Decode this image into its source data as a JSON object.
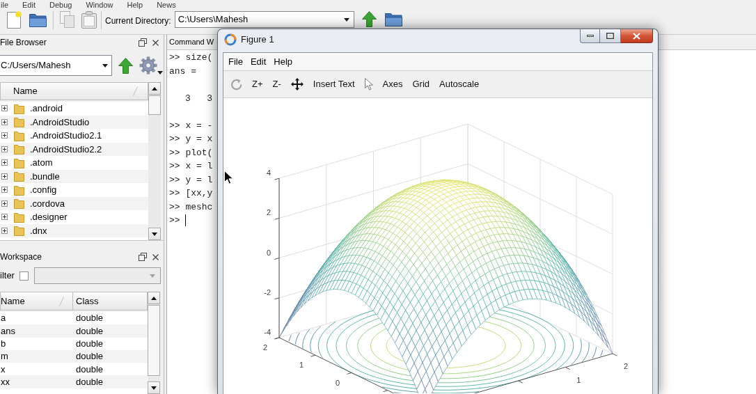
{
  "menu_bar": [
    "ile",
    "Edit",
    "Debug",
    "Window",
    "Help",
    "News"
  ],
  "toolbar": {
    "directory_label": "Current Directory:",
    "directory": "C:\\Users\\Mahesh"
  },
  "file_browser": {
    "title": "File Browser",
    "path": "C:/Users/Mahesh",
    "column": "Name",
    "items": [
      {
        "name": ".android",
        "expanded": false
      },
      {
        "name": ".AndroidStudio",
        "expanded": false
      },
      {
        "name": ".AndroidStudio2.1",
        "expanded": false
      },
      {
        "name": ".AndroidStudio2.2",
        "expanded": false
      },
      {
        "name": ".atom",
        "expanded": false
      },
      {
        "name": ".bundle",
        "expanded": false
      },
      {
        "name": ".config",
        "expanded": false
      },
      {
        "name": ".cordova",
        "expanded": false
      },
      {
        "name": ".designer",
        "expanded": false
      },
      {
        "name": ".dnx",
        "expanded": false
      }
    ]
  },
  "workspace": {
    "title": "Workspace",
    "filter": {
      "label": "ilter",
      "checked": false
    },
    "columns": [
      "Name",
      "Class"
    ],
    "rows": [
      {
        "name": "a",
        "class": "double"
      },
      {
        "name": "ans",
        "class": "double"
      },
      {
        "name": "b",
        "class": "double"
      },
      {
        "name": "m",
        "class": "double"
      },
      {
        "name": "x",
        "class": "double"
      },
      {
        "name": "xx",
        "class": "double"
      }
    ]
  },
  "command_window": {
    "title": "Command W",
    "lines": [
      {
        "kind": "input",
        "text": ">> size("
      },
      {
        "kind": "output",
        "text": "ans ="
      },
      {
        "kind": "value",
        "text": "3   3"
      },
      {
        "kind": "input",
        "text": ">> x = -"
      },
      {
        "kind": "input",
        "text": ">> y = x"
      },
      {
        "kind": "input",
        "text": ">> plot("
      },
      {
        "kind": "input",
        "text": ">> x = l"
      },
      {
        "kind": "input",
        "text": ">> y = l"
      },
      {
        "kind": "input",
        "text": ">> [xx,y"
      },
      {
        "kind": "input",
        "text": ">> meshc"
      },
      {
        "kind": "prompt",
        "text": ">>"
      }
    ]
  },
  "figure": {
    "title": "Figure 1",
    "menu": [
      "File",
      "Edit",
      "Help"
    ],
    "toolbar": [
      "Z+",
      "Z-",
      "Insert Text",
      "Axes",
      "Grid",
      "Autoscale"
    ],
    "plot": {
      "z_ticks": [
        "4",
        "2",
        "0",
        "-2",
        "-4"
      ],
      "left_floor_ticks": [
        "2",
        "1",
        "0"
      ],
      "right_floor_ticks": [
        "2",
        "1"
      ]
    }
  }
}
